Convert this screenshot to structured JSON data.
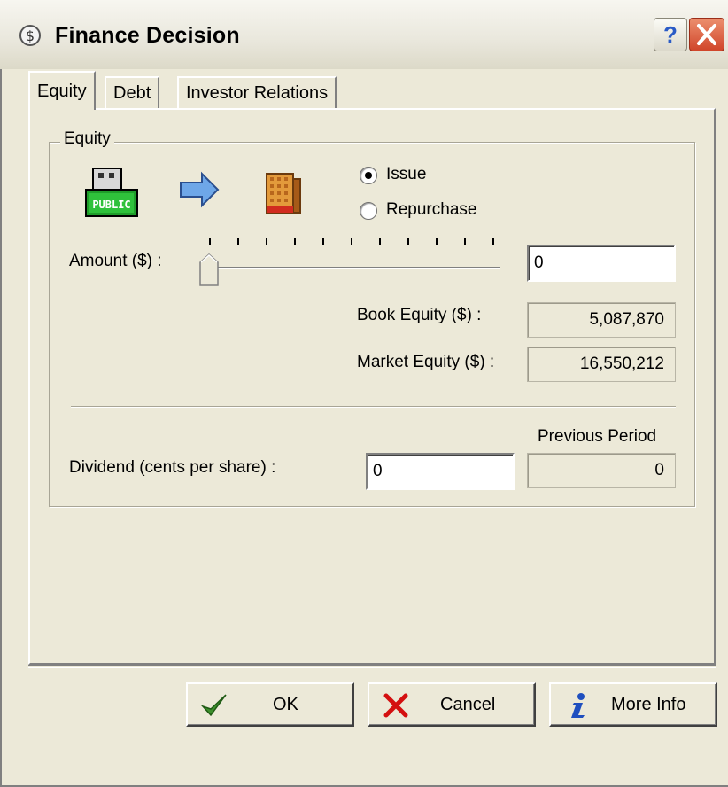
{
  "window": {
    "title": "Finance Decision"
  },
  "tabs": [
    {
      "label": "Equity"
    },
    {
      "label": "Debt"
    },
    {
      "label": "Investor Relations"
    }
  ],
  "equity_group": {
    "label": "Equity",
    "icons": [
      "public-market-icon",
      "arrow-right-icon",
      "company-building-icon"
    ],
    "radio_issue": {
      "label": "Issue",
      "selected": true
    },
    "radio_repurchase": {
      "label": "Repurchase",
      "selected": false
    },
    "amount": {
      "label": "Amount ($) :",
      "value": "0",
      "slider_level": 0
    },
    "book_equity": {
      "label": "Book Equity ($) :",
      "value": "5,087,870"
    },
    "market_equity": {
      "label": "Market Equity ($) :",
      "value": "16,550,212"
    },
    "previous_period_header": "Previous Period",
    "dividend": {
      "label": "Dividend (cents per share) :",
      "value": "0",
      "previous": "0"
    }
  },
  "buttons": {
    "ok": "OK",
    "cancel": "Cancel",
    "more_info": "More Info"
  },
  "colors": {
    "ok_check": "#3c8f2c",
    "cancel_x": "#d41010",
    "info_icon": "#1f4fbf"
  }
}
